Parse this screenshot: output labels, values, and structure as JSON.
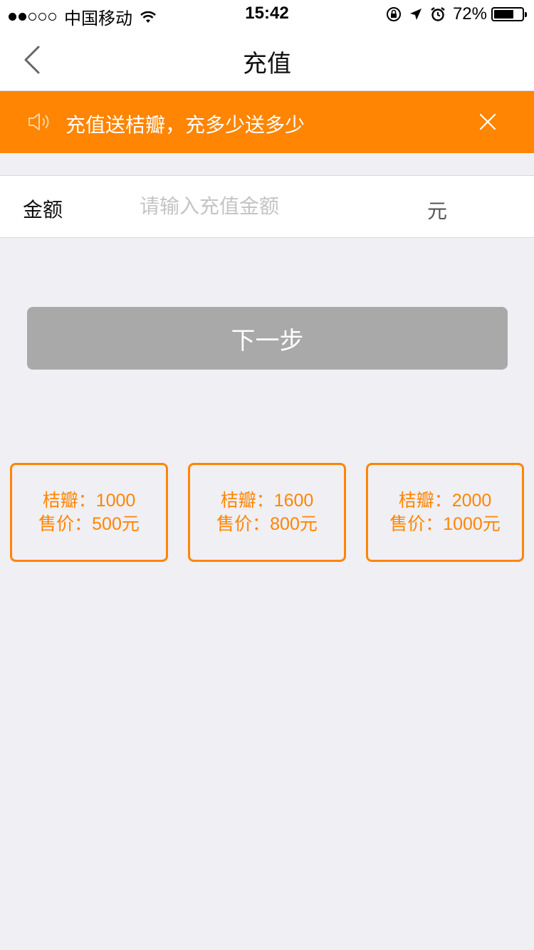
{
  "status_bar": {
    "carrier": "中国移动",
    "time": "15:42",
    "battery_percent": "72%",
    "battery_level": 0.72
  },
  "nav": {
    "title": "充值",
    "back_icon": "chevron-left-icon"
  },
  "banner": {
    "message": "充值送桔瓣，充多少送多少",
    "background": "#ff8502",
    "icons": [
      "speaker-icon",
      "close-icon"
    ]
  },
  "amount": {
    "label": "金额",
    "placeholder": "请输入充值金额",
    "value": "",
    "unit": "元"
  },
  "next_button": {
    "label": "下一步",
    "color": "#a9a9a9"
  },
  "packages": [
    {
      "line1": "桔瓣：1000",
      "line2": "售价：500元"
    },
    {
      "line1": "桔瓣：1600",
      "line2": "售价：800元"
    },
    {
      "line1": "桔瓣：2000",
      "line2": "售价：1000元"
    }
  ],
  "accent_color": "#ff8502"
}
